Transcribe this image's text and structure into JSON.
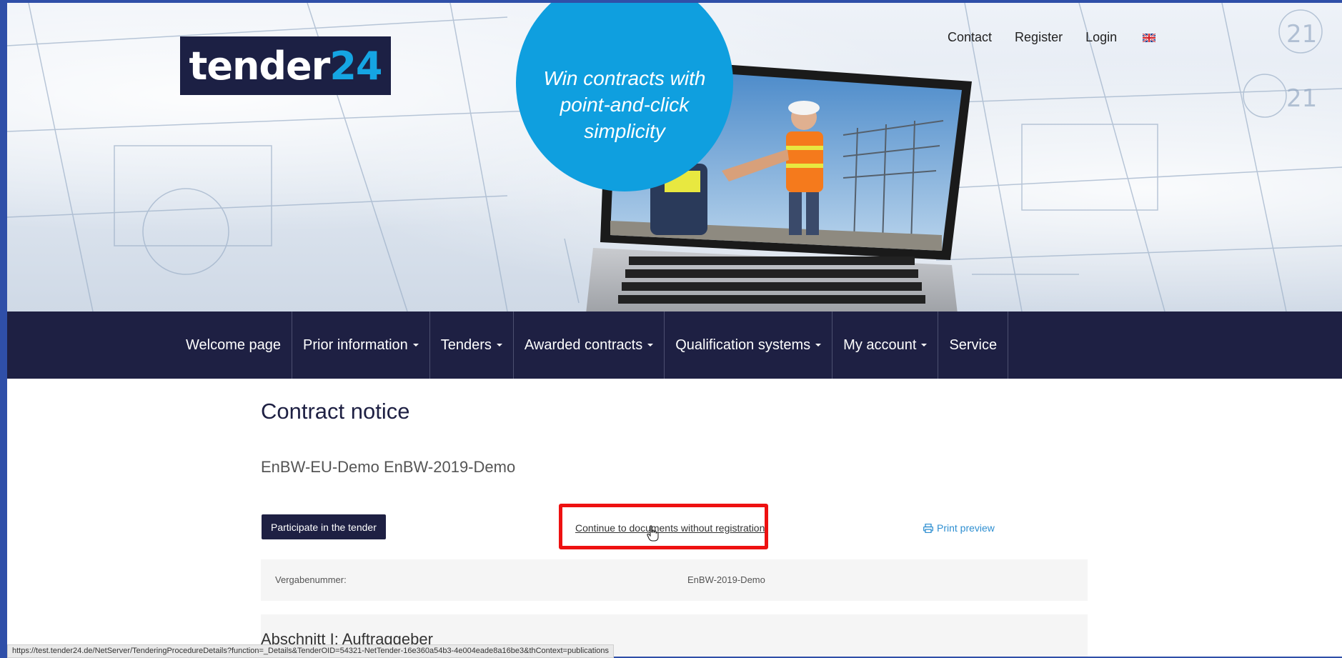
{
  "header": {
    "logo": {
      "text_white": "tender",
      "text_blue": "24"
    },
    "promo_text": "Win contracts with point-and-click simplicity",
    "top_links": {
      "contact": "Contact",
      "register": "Register",
      "login": "Login"
    },
    "language_flag": "uk-flag-icon"
  },
  "nav": {
    "items": [
      {
        "label": "Welcome page",
        "dropdown": false
      },
      {
        "label": "Prior information",
        "dropdown": true
      },
      {
        "label": "Tenders",
        "dropdown": true
      },
      {
        "label": "Awarded contracts",
        "dropdown": true
      },
      {
        "label": "Qualification systems",
        "dropdown": true
      },
      {
        "label": "My account",
        "dropdown": true
      },
      {
        "label": "Service",
        "dropdown": false
      }
    ]
  },
  "content": {
    "page_title": "Contract notice",
    "tender_name": "EnBW-EU-Demo EnBW-2019-Demo",
    "participate_button": "Participate in the tender",
    "continue_link": "Continue to documents without registration",
    "print_link": "Print preview",
    "info": {
      "label": "Vergabenummer:",
      "value": "EnBW-2019-Demo"
    },
    "section_title": "Abschnitt I: Auftraggeber"
  },
  "status_bar": {
    "url": "https://test.tender24.de/NetServer/TenderingProcedureDetails?function=_Details&TenderOID=54321-NetTender-16e360a54b3-4e004eade8a16be3&thContext=publications"
  },
  "colors": {
    "navy": "#1e2043",
    "accent_blue": "#0f9fdf",
    "highlight_red": "#ee1111",
    "link_blue": "#2f8fd1",
    "outer_border": "#2f4fa8"
  }
}
